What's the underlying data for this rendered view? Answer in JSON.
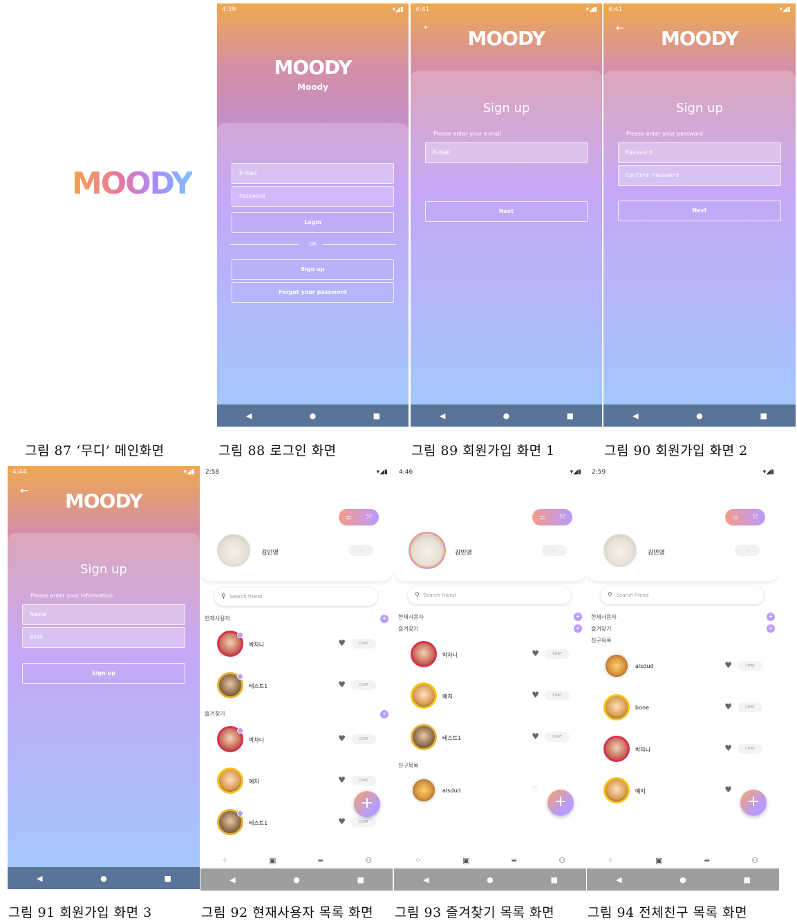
{
  "splash": {
    "logo": "MOODY"
  },
  "login": {
    "status_time": "4:39",
    "logo": "MOODY",
    "subtitle": "Moody",
    "email_placeholder": "E-mail",
    "password_placeholder": "Password",
    "login_label": "Login",
    "or_label": "OR",
    "signup_label": "Sign up",
    "forgot_label": "Forget your password"
  },
  "signup1": {
    "status_time": "4:41",
    "logo": "MOODY",
    "title": "Sign up",
    "hint": "Please enter your e-mail",
    "email_placeholder": "E-mail",
    "next_label": "Next"
  },
  "signup2": {
    "status_time": "4:41",
    "logo": "MOODY",
    "title": "Sign up",
    "hint": "Please enter your password",
    "password_placeholder": "Password",
    "confirm_placeholder": "Confirm Password",
    "next_label": "Next"
  },
  "signup3": {
    "status_time": "4:44",
    "logo": "MOODY",
    "title": "Sign up",
    "hint": "Please enter your information",
    "name_placeholder": "Name",
    "birth_placeholder": "Birth",
    "signup_label": "Sign up"
  },
  "list_current": {
    "status_time": "2:58",
    "me_name": "김민영",
    "search_placeholder": "Search friend",
    "section_current": "현재사용자",
    "section_favorite": "즐겨찾기",
    "current": [
      {
        "name": "박차니"
      },
      {
        "name": "테스트1"
      }
    ],
    "favorites": [
      {
        "name": "박차니"
      },
      {
        "name": "예지"
      },
      {
        "name": "테스트1"
      }
    ],
    "chat_label": "CHAT"
  },
  "list_favorite": {
    "status_time": "4:46",
    "me_name": "김민영",
    "search_placeholder": "Search friend",
    "section_current": "현재사용자",
    "section_favorite": "즐겨찾기",
    "section_friends": "친구목록",
    "favorites": [
      {
        "name": "박차니"
      },
      {
        "name": "예지"
      },
      {
        "name": "테스트1"
      }
    ],
    "friends": [
      {
        "name": "alsdud"
      }
    ],
    "chat_label": "CHAT"
  },
  "list_friends": {
    "status_time": "2:59",
    "me_name": "김민영",
    "search_placeholder": "Search friend",
    "section_current": "현재사용자",
    "section_favorite": "즐겨찾기",
    "section_friends": "친구목록",
    "friends": [
      {
        "name": "alsdud"
      },
      {
        "name": "bone"
      },
      {
        "name": "박차니"
      },
      {
        "name": "예지"
      }
    ],
    "chat_label": "CHAT"
  },
  "captions": {
    "c87": "그림 87 ‘무디’ 메인화면",
    "c88": "그림 88 로그인 화면",
    "c89": "그림 89 회원가입 화면 1",
    "c90": "그림 90 회원가입 화면 2",
    "c91": "그림 91 회원가입 화면 3",
    "c92": "그림 92 현재사용자 목록 화면",
    "c93": "그림 93 즐겨찾기 목록 화면",
    "c94": "그림 94 전체친구 목록 화면"
  },
  "colors": {
    "gradient_top": "#efa84f",
    "gradient_mid": "#b590f6",
    "gradient_bottom": "#87bdfd",
    "accent": "#b79bff",
    "navbar": "#5a7399"
  },
  "icons": {
    "back": "arrow-left-icon",
    "nav_back": "triangle-left-icon",
    "nav_home": "circle-home-icon",
    "nav_recent": "square-recent-icon",
    "search": "search-icon",
    "fab": "plus-icon",
    "heart": "heart-icon"
  }
}
